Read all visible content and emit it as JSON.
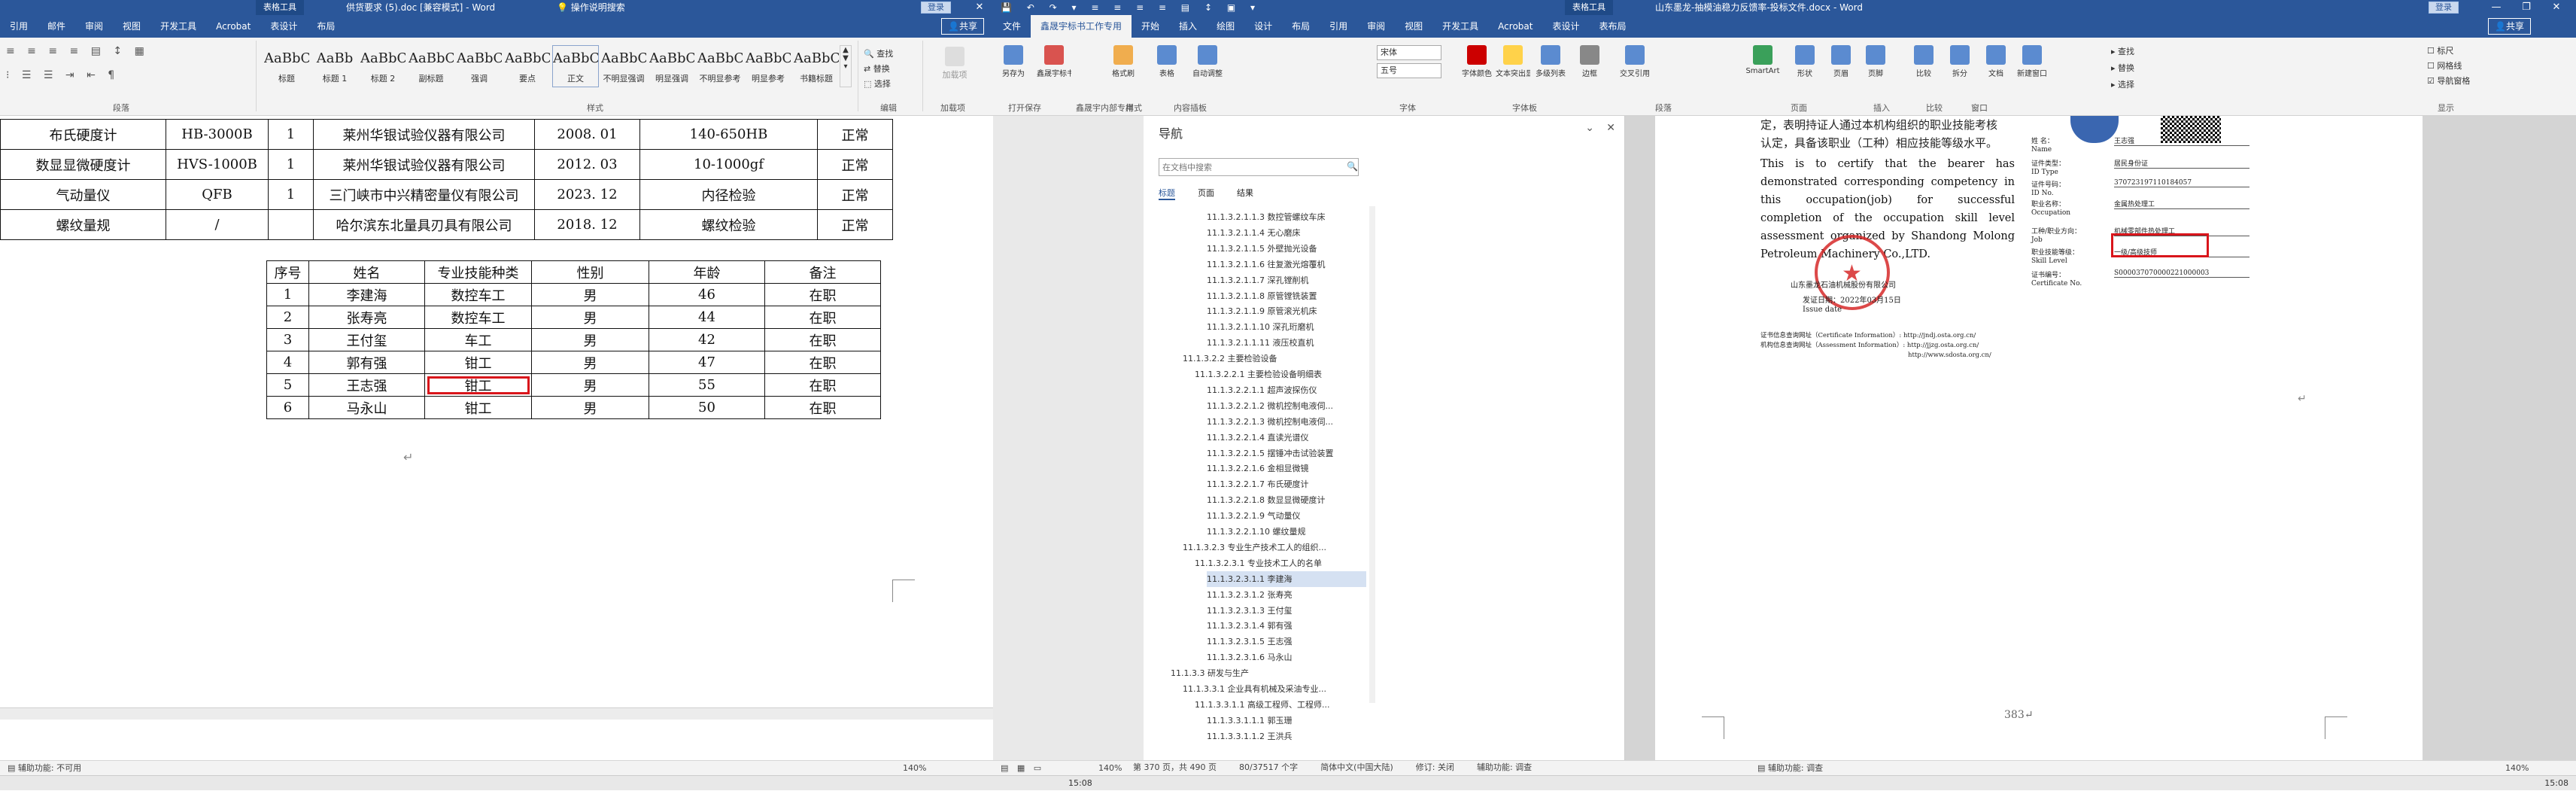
{
  "left_window": {
    "context_tab": "表格工具",
    "title": "供货要求 (5).doc [兼容模式] - Word",
    "search_prompt": "操作说明搜索",
    "sign_in": "登录",
    "share": "共享",
    "tabs": [
      "引用",
      "邮件",
      "审阅",
      "视图",
      "开发工具",
      "Acrobat",
      "表设计",
      "布局"
    ],
    "ribbon_groups": {
      "paragraph": "段落",
      "styles": "样式",
      "editing": "编辑",
      "addins": "加载项"
    },
    "styles": [
      {
        "sample": "AaBbC",
        "name": "标题"
      },
      {
        "sample": "AaBb",
        "name": "标题 1"
      },
      {
        "sample": "AaBbC",
        "name": "标题 2"
      },
      {
        "sample": "AaBbC",
        "name": "副标题"
      },
      {
        "sample": "AaBbCcDd",
        "name": "强调"
      },
      {
        "sample": "AaBbCcDd",
        "name": "要点"
      },
      {
        "sample": "AaBbCcDd",
        "name": "正文"
      },
      {
        "sample": "AaBbCcDd",
        "name": "不明显强调"
      },
      {
        "sample": "AaBbCcDd",
        "name": "明显强调"
      },
      {
        "sample": "AaBbCcDd",
        "name": "不明显参考"
      },
      {
        "sample": "AaBbCcDd",
        "name": "明显参考"
      },
      {
        "sample": "AaBbCcDd",
        "name": "书籍标题"
      }
    ],
    "editing": [
      "查找",
      "替换",
      "选择"
    ],
    "addins_btn": "加载项",
    "equipment_rows": [
      [
        "布氏硬度计",
        "HB-3000B",
        "1",
        "莱州华银试验仪器有限公司",
        "2008. 01",
        "140-650HB",
        "正常"
      ],
      [
        "数显显微硬度计",
        "HVS-1000B",
        "1",
        "莱州华银试验仪器有限公司",
        "2012. 03",
        "10-1000gf",
        "正常"
      ],
      [
        "气动量仪",
        "QFB",
        "1",
        "三门峡市中兴精密量仪有限公司",
        "2023. 12",
        "内径检验",
        "正常"
      ],
      [
        "螺纹量规",
        "/",
        "",
        "哈尔滨东北量具刃具有限公司",
        "2018. 12",
        "螺纹检验",
        "正常"
      ]
    ],
    "staff_header": [
      "序号",
      "姓名",
      "专业技能种类",
      "性别",
      "年龄",
      "备注"
    ],
    "staff_rows": [
      [
        "1",
        "李建海",
        "数控车工",
        "男",
        "46",
        "在职"
      ],
      [
        "2",
        "张寿亮",
        "数控车工",
        "男",
        "44",
        "在职"
      ],
      [
        "3",
        "王付玺",
        "车工",
        "男",
        "42",
        "在职"
      ],
      [
        "4",
        "郭有强",
        "钳工",
        "男",
        "47",
        "在职"
      ],
      [
        "5",
        "王志强",
        "钳工",
        "男",
        "55",
        "在职"
      ],
      [
        "6",
        "马永山",
        "钳工",
        "男",
        "50",
        "在职"
      ]
    ],
    "status": [
      "第 370 页，共 490 页",
      "80/37517 个字",
      "简体中文(中国大陆)",
      "修订: 关闭",
      "辅助功能: 调查",
      "140%"
    ]
  },
  "right_window": {
    "context_tab": "表格工具",
    "title": "山东墨龙-抽模油稳力反馈率-投标文件.docx - Word",
    "sign_in": "登录",
    "share": "共享",
    "tabs": [
      "文件",
      "鑫晟宇标书工作专用",
      "开始",
      "插入",
      "绘图",
      "设计",
      "布局",
      "引用",
      "审阅",
      "视图",
      "开发工具",
      "Acrobat",
      "表设计",
      "表布局"
    ],
    "font_name": "宋体",
    "font_size": "五号",
    "ribbon_groups": {
      "sign": "打开保存",
      "dingding": "鑫晟宇内部专用",
      "style": "样式",
      "content": "内容插板",
      "font": "字体",
      "text": "字体板",
      "paragraph": "段落",
      "page": "页面",
      "insert": "插入",
      "compare": "比较",
      "window": "窗口",
      "display": "显示"
    },
    "ribbon_buttons": [
      "另存为",
      "鑫晟宇标书工作专用",
      "格式刷",
      "表格",
      "自动调整",
      "字体颜色",
      "文本突出显示",
      "多级列表",
      "边框",
      "交叉引用",
      "SmartArt",
      "形状",
      "页眉",
      "页脚",
      "比较",
      "拆分",
      "文档",
      "新建窗口",
      "查找",
      "替换",
      "选择"
    ],
    "display_options": [
      "标尺",
      "网格线",
      "导航窗格"
    ],
    "nav": {
      "title": "导航",
      "search_placeholder": "在文档中搜索",
      "tabs": [
        "标题",
        "页面",
        "结果"
      ],
      "items": [
        "11.1.3.2.1.1.3 数控管螺纹车床",
        "11.1.3.2.1.1.4 无心磨床",
        "11.1.3.2.1.1.5 外壁抛光设备",
        "11.1.3.2.1.1.6 往复激光熔覆机",
        "11.1.3.2.1.1.7 深孔镗削机",
        "11.1.3.2.1.1.8 原管镗铣装置",
        "11.1.3.2.1.1.9 原管滚光机床",
        "11.1.3.2.1.1.10 深孔珩磨机",
        "11.1.3.2.1.1.11 液压校直机",
        "11.1.3.2.2 主要检验设备",
        "11.1.3.2.2.1 主要检验设备明细表",
        "11.1.3.2.2.1.1 超声波探伤仪",
        "11.1.3.2.2.1.2 微机控制电液伺...",
        "11.1.3.2.2.1.3 微机控制电液伺...",
        "11.1.3.2.2.1.4 直读光谱仪",
        "11.1.3.2.2.1.5 摆锤冲击试验装置",
        "11.1.3.2.2.1.6 金相显微镜",
        "11.1.3.2.2.1.7 布氏硬度计",
        "11.1.3.2.2.1.8 数显显微硬度计",
        "11.1.3.2.2.1.9 气动量仪",
        "11.1.3.2.2.1.10 螺纹量规",
        "11.1.3.2.3 专业生产技术工人的组织...",
        "11.1.3.2.3.1 专业技术工人的名单",
        "11.1.3.2.3.1.1 李建海",
        "11.1.3.2.3.1.2 张寿亮",
        "11.1.3.2.3.1.3 王付玺",
        "11.1.3.2.3.1.4 郭有强",
        "11.1.3.2.3.1.5 王志强",
        "11.1.3.2.3.1.6 马永山",
        "11.1.3.3 研发与生产",
        "11.1.3.3.1 企业具有机械及采油专业...",
        "11.1.3.3.1.1 高级工程师、工程师...",
        "11.1.3.3.1.1.1 郭玉珊",
        "11.1.3.3.1.1.2 王洪兵"
      ]
    },
    "cert": {
      "cn_body_1": "定，表明持证人通过本机构组织的职业技能考核",
      "cn_body_2": "认定，具备该职业（工种）相应技能等级水平。",
      "en_body": "This is to certify that the bearer has demonstrated corresponding competency in this occupation(job) for successful completion of the occupation skill level assessment organized by Shandong Molong Petroleum Machinery Co.,LTD.",
      "issuer": "山东墨龙石油机械股份有限公司",
      "date_label": "发证日期：",
      "date_value": "2022年03月15日",
      "issue_date_en": "Issue date",
      "info_line_1": "证书信息查询网址（Certificate Information）: http://jndj.osta.org.cn/",
      "info_line_2": "机构信息查询网址（Assessment Information）: http://jjzg.osta.org.cn/",
      "info_line_3": "http://www.sdosta.org.cn/",
      "fields": [
        {
          "cn": "姓 名：",
          "en": "Name",
          "value": "王志强"
        },
        {
          "cn": "证件类型：",
          "en": "ID Type",
          "value": "居民身份证"
        },
        {
          "cn": "证件号码：",
          "en": "ID No.",
          "value": "370723197110184057"
        },
        {
          "cn": "职业名称：",
          "en": "Occupation",
          "value": "金属热处理工"
        },
        {
          "cn": "工种/职业方向：",
          "en": "Job",
          "value": "机械零部件热处理工"
        },
        {
          "cn": "职业技能等级：",
          "en": "Skill Level",
          "value": "一级/高级技师"
        },
        {
          "cn": "证书编号：",
          "en": "Certificate No.",
          "value": "S000037070000221000003"
        }
      ],
      "page_number": "383"
    },
    "status": [
      "140%",
      "辅助功能: 调查"
    ]
  },
  "taskbar": {
    "time": "15:08"
  },
  "colors": {
    "word_blue": "#2b579a",
    "highlight_red": "#d9151b",
    "seal_red": "#d62a2a"
  }
}
